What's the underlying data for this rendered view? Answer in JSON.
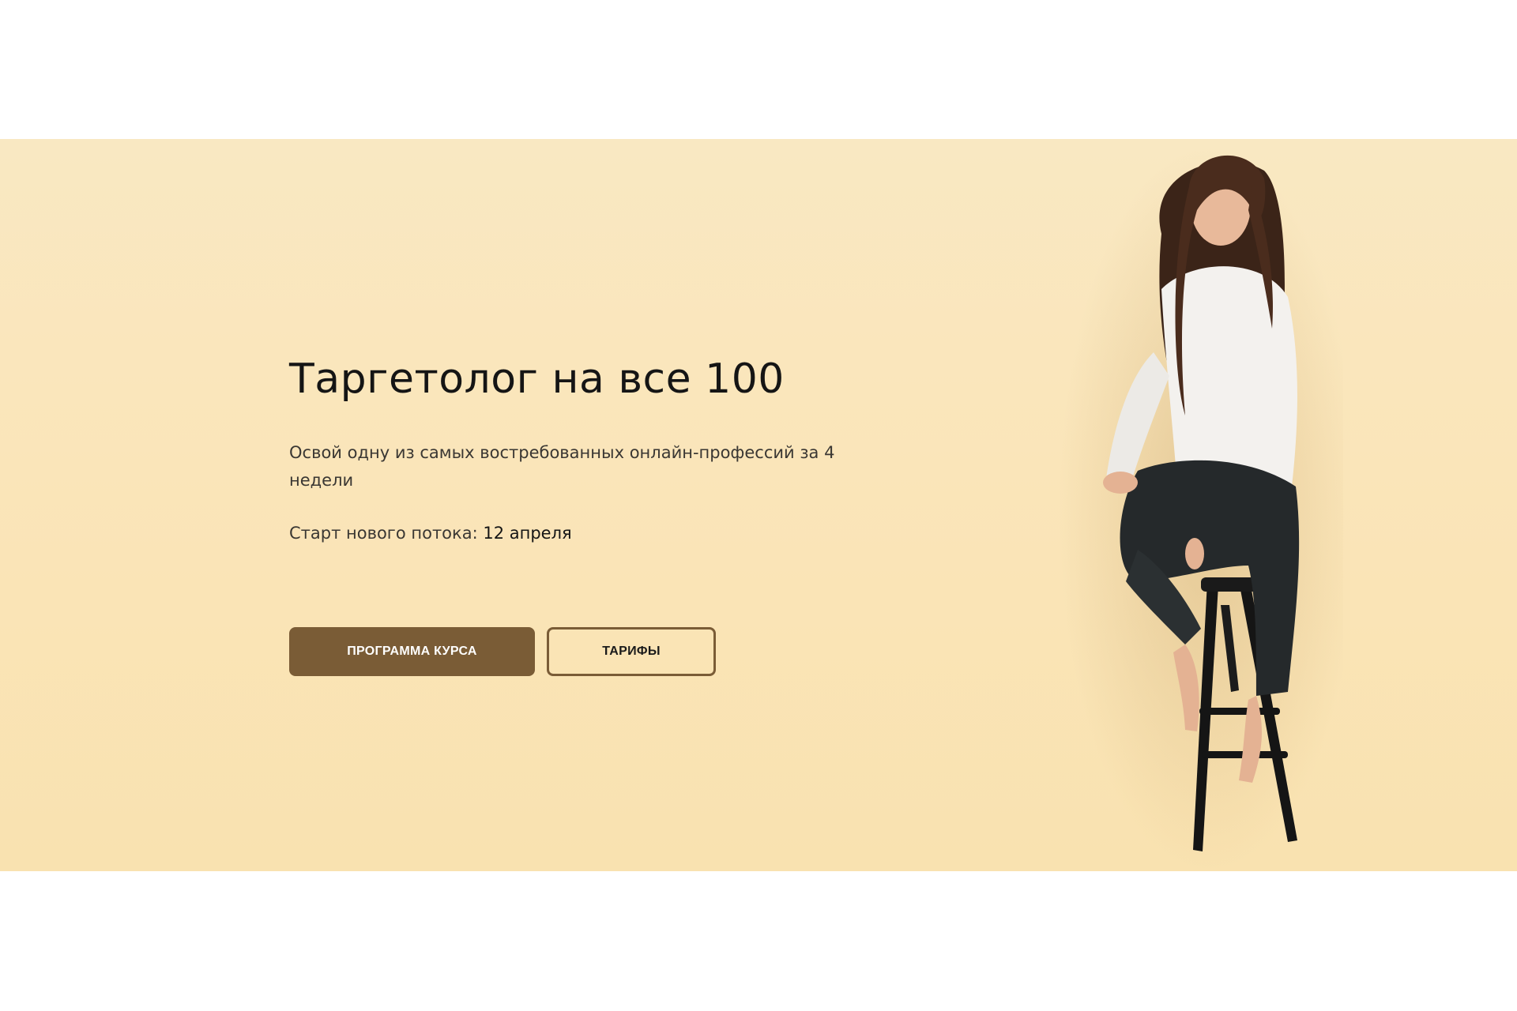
{
  "hero": {
    "title": "Таргетолог на все 100",
    "subtitle": "Освой одну из самых востребованных онлайн-профессий за 4 недели",
    "start_label": "Старт нового потока: ",
    "start_date": "12 апреля",
    "buttons": {
      "program": "ПРОГРАММА КУРСА",
      "tariffs": "ТАРИФЫ"
    }
  },
  "colors": {
    "hero_background": "#fae5b9",
    "accent": "#7a5c36",
    "text": "#151515"
  },
  "image": {
    "description_icon": "woman-on-stool-photo"
  }
}
